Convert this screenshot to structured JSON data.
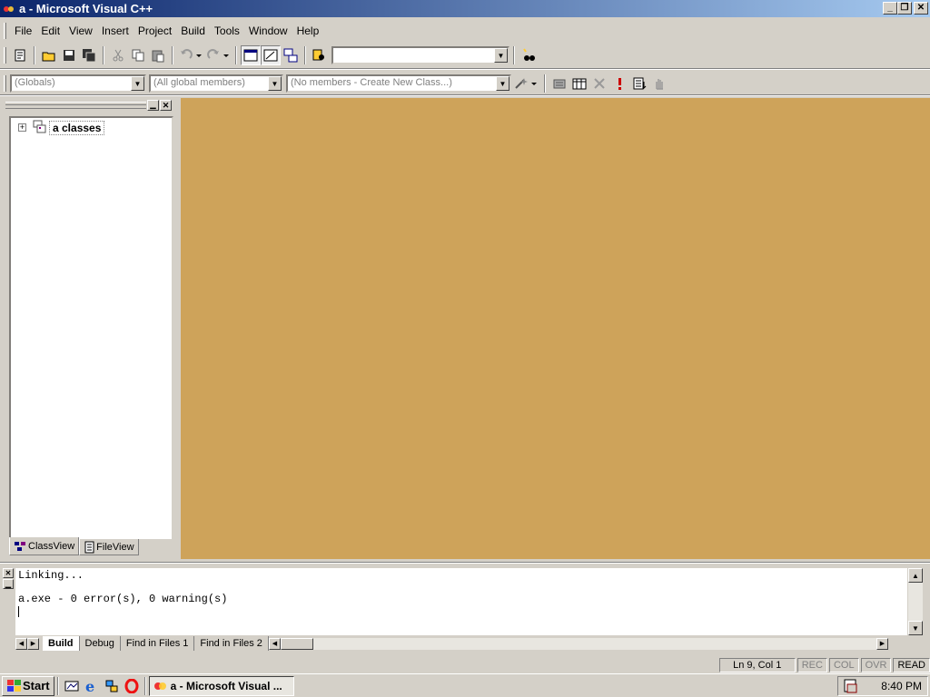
{
  "window": {
    "title": "a - Microsoft Visual C++"
  },
  "menu": [
    "File",
    "Edit",
    "View",
    "Insert",
    "Project",
    "Build",
    "Tools",
    "Window",
    "Help"
  ],
  "wizardbar": {
    "class_combo": "(Globals)",
    "filter_combo": "(All global members)",
    "members_combo": "(No members - Create New Class...)"
  },
  "find_combo": {
    "value": ""
  },
  "workspace": {
    "tree_root": "a classes",
    "tabs": [
      "ClassView",
      "FileView"
    ]
  },
  "editor": {
    "background": "#cea35a"
  },
  "output": {
    "lines": [
      "Linking...",
      "",
      "a.exe - 0 error(s), 0 warning(s)"
    ],
    "tabs": [
      "Build",
      "Debug",
      "Find in Files 1",
      "Find in Files 2"
    ]
  },
  "statusbar": {
    "position": "Ln 9, Col 1",
    "indicators": [
      "REC",
      "COL",
      "OVR",
      "READ"
    ]
  },
  "taskbar": {
    "start": "Start",
    "task": "a - Microsoft Visual ...",
    "clock": "8:40 PM"
  },
  "icons": {
    "title": "vc-app-icon",
    "toolbar": [
      "new-file-icon",
      "open-icon",
      "save-icon",
      "save-all-icon",
      "cut-icon",
      "copy-icon",
      "paste-icon",
      "undo-icon",
      "redo-icon",
      "workspace-icon",
      "output-icon",
      "window-list-icon",
      "find-in-files-icon",
      "find-icon"
    ],
    "wizard": [
      "wizard-action-icon",
      "compile-icon",
      "build-icon",
      "stop-build-icon",
      "execute-icon",
      "go-icon",
      "breakpoint-icon"
    ]
  }
}
